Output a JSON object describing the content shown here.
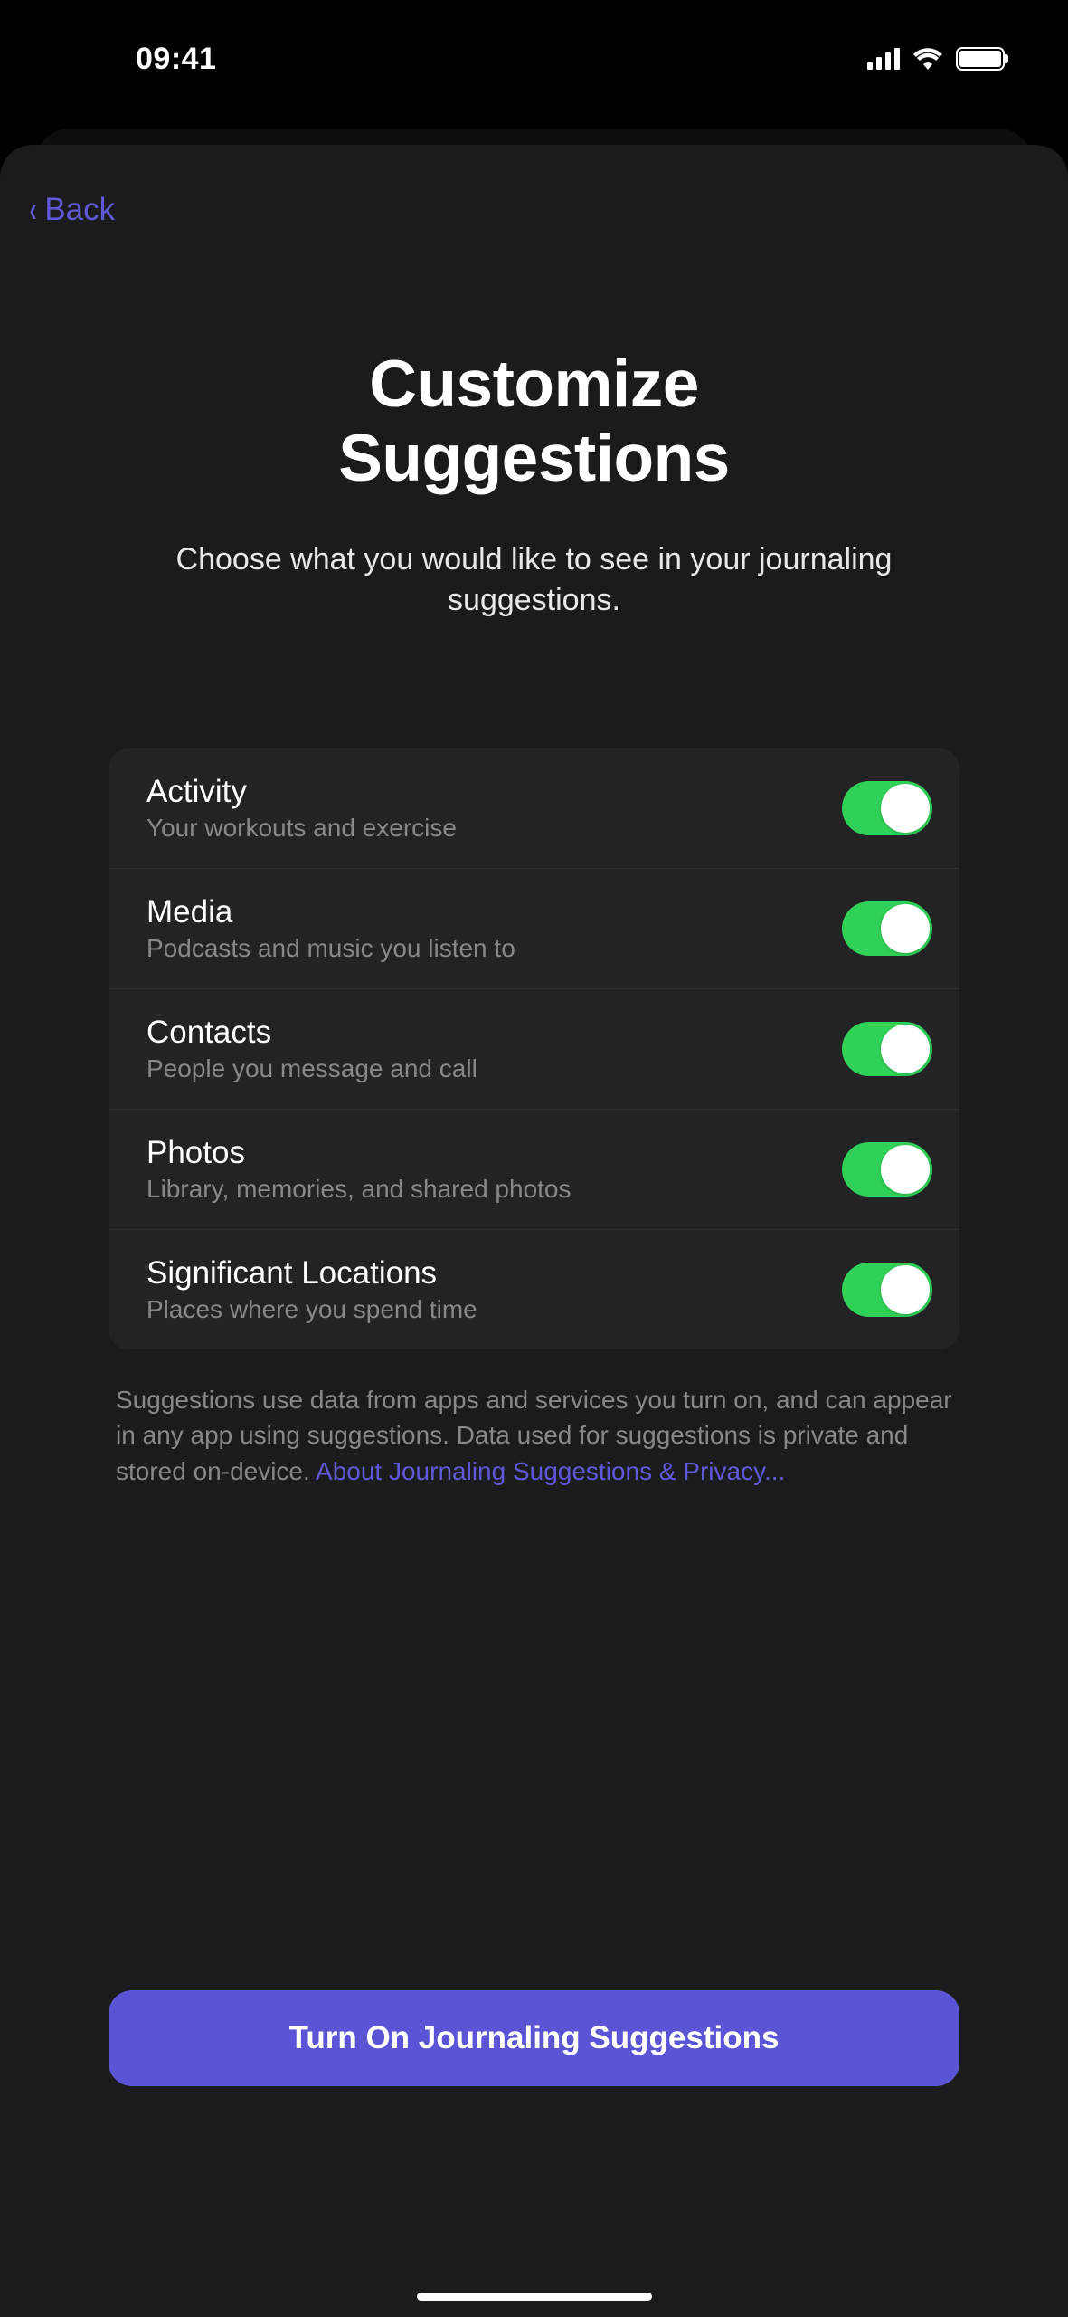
{
  "status": {
    "time": "09:41"
  },
  "nav": {
    "back_label": "Back"
  },
  "header": {
    "title_line1": "Customize",
    "title_line2": "Suggestions",
    "subtitle": "Choose what you would like to see in your journaling suggestions."
  },
  "items": [
    {
      "id": "activity",
      "title": "Activity",
      "desc": "Your workouts and exercise",
      "on": true
    },
    {
      "id": "media",
      "title": "Media",
      "desc": "Podcasts and music you listen to",
      "on": true
    },
    {
      "id": "contacts",
      "title": "Contacts",
      "desc": "People you message and call",
      "on": true
    },
    {
      "id": "photos",
      "title": "Photos",
      "desc": "Library, memories, and shared photos",
      "on": true
    },
    {
      "id": "locations",
      "title": "Significant Locations",
      "desc": "Places where you spend time",
      "on": true
    }
  ],
  "footer": {
    "text": "Suggestions use data from apps and services you turn on, and can appear in any app using suggestions. Data used for suggestions is private and stored on-device. ",
    "link": "About Journaling Suggestions & Privacy..."
  },
  "cta": {
    "label": "Turn On Journaling Suggestions"
  }
}
